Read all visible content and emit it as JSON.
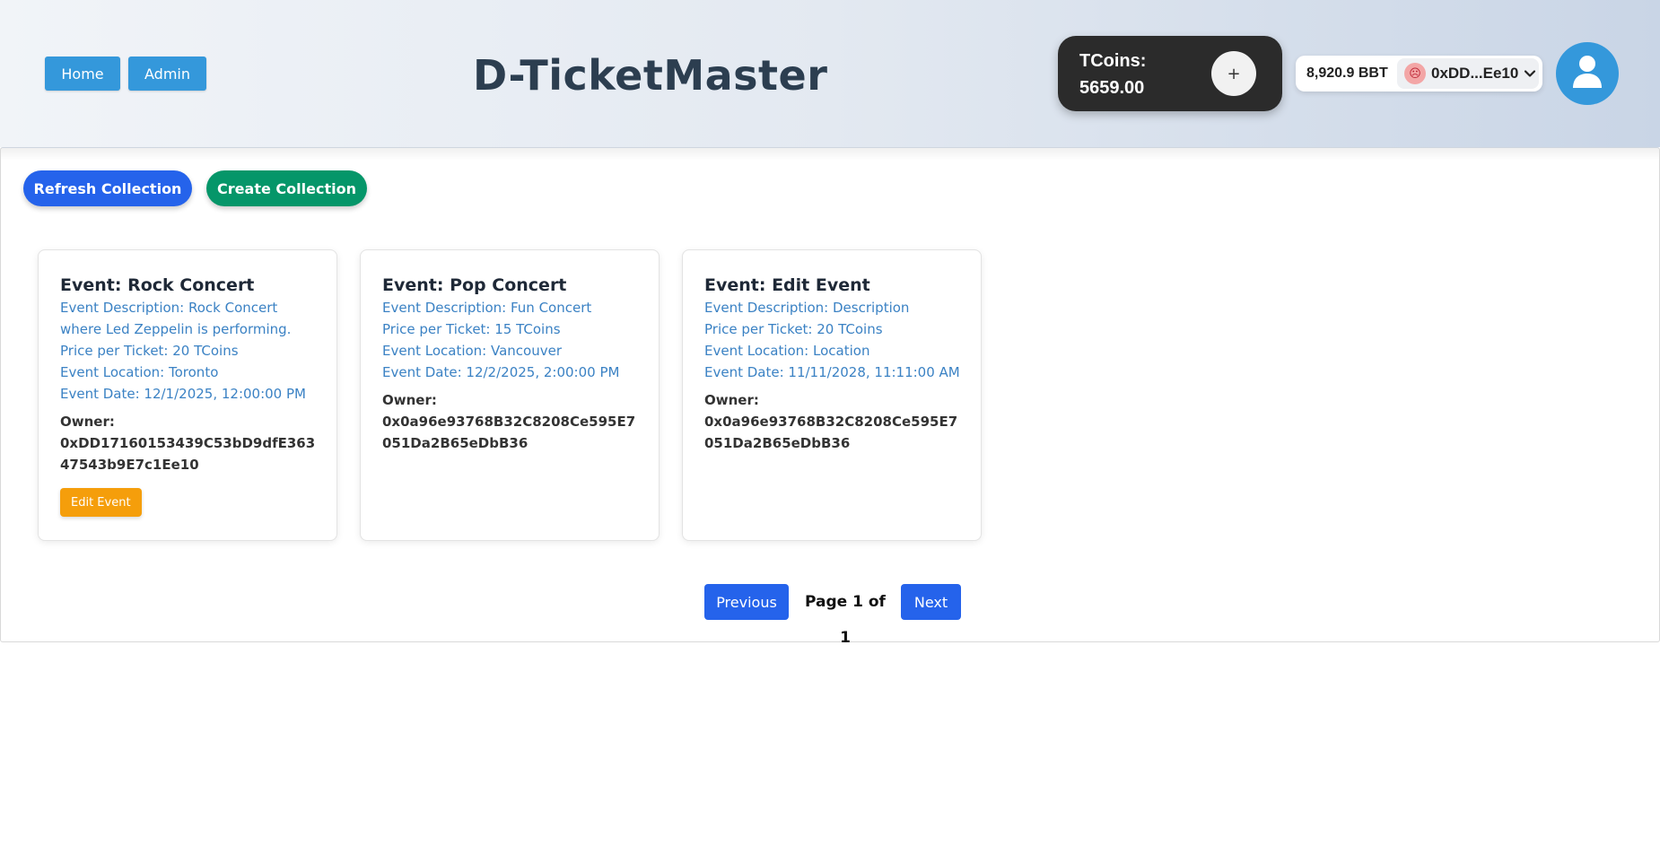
{
  "header": {
    "nav": {
      "home_label": "Home",
      "admin_label": "Admin"
    },
    "title": "D-TicketMaster",
    "tcoins": {
      "label": "TCoins:",
      "value": "5659.00",
      "add_label": "+"
    },
    "wallet": {
      "balance": "8,920.9 BBT",
      "address": "0xDD...Ee10",
      "avatar": "☹",
      "chevron": "⌄"
    },
    "profile_icon": "user-icon"
  },
  "actions": {
    "refresh_label": "Refresh Collection",
    "create_label": "Create Collection"
  },
  "events": [
    {
      "title": "Event: Rock Concert",
      "description": "Event Description: Rock Concert where Led Zeppelin is performing.",
      "price": "Price per Ticket: 20 TCoins",
      "location": "Event Location: Toronto",
      "date": "Event Date: 12/1/2025, 12:00:00 PM",
      "owner_label": "Owner:",
      "owner": "0xDD17160153439C53bD9dfE36347543b9E7c1Ee10",
      "edit_label": "Edit Event"
    },
    {
      "title": "Event: Pop Concert",
      "description": "Event Description: Fun Concert",
      "price": "Price per Ticket: 15 TCoins",
      "location": "Event Location: Vancouver",
      "date": "Event Date: 12/2/2025, 2:00:00 PM",
      "owner_label": "Owner:",
      "owner": "0x0a96e93768B32C8208Ce595E7051Da2B65eDbB36"
    },
    {
      "title": "Event: Edit Event",
      "description": "Event Description: Description",
      "price": "Price per Ticket: 20 TCoins",
      "location": "Event Location: Location",
      "date": "Event Date: 11/11/2028, 11:11:00 AM",
      "owner_label": "Owner:",
      "owner": "0x0a96e93768B32C8208Ce595E7051Da2B65eDbB36"
    }
  ],
  "pagination": {
    "prev_label": "Previous",
    "page_label": "Page 1 of 1",
    "next_label": "Next"
  },
  "colors": {
    "nav_blue": "#3498db",
    "primary": "#2563eb",
    "success": "#059669",
    "warning": "#f59e0b",
    "link": "#3b82c4"
  }
}
